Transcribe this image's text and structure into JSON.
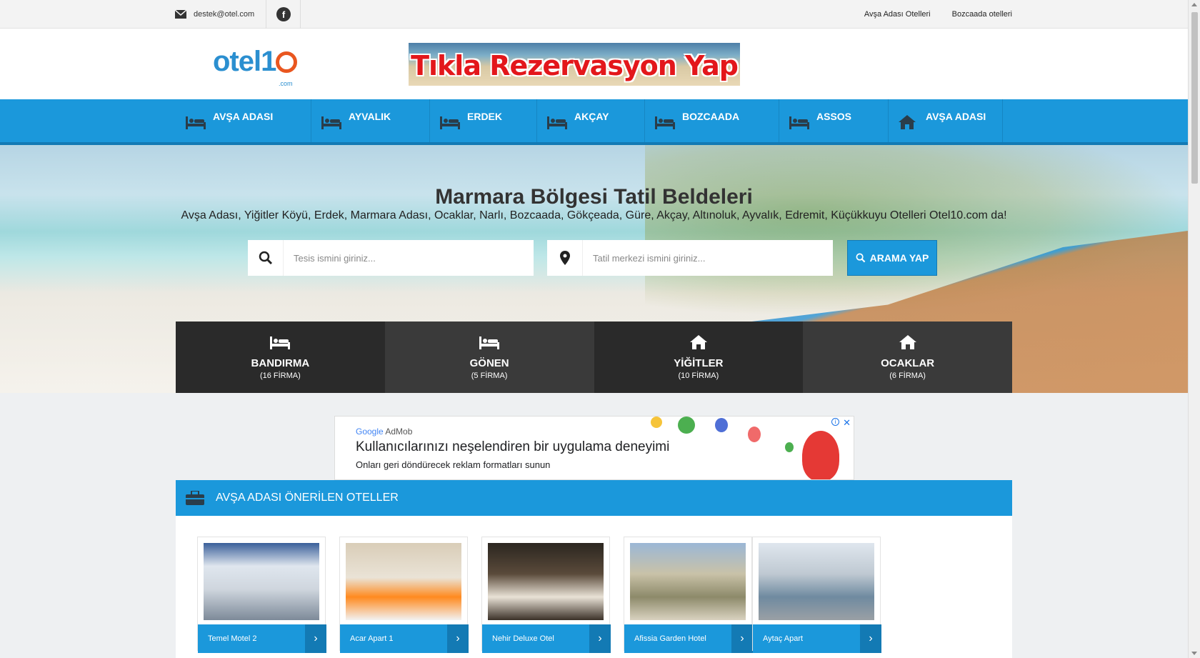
{
  "topbar": {
    "email": "destek@otel.com",
    "facebook_icon": "facebook-icon",
    "links": [
      "Avşa Adası Otelleri",
      "Bozcaada otelleri"
    ]
  },
  "header": {
    "logo_text_a": "otel1",
    "logo_text_b": ".com",
    "banner_text": "Tıkla Rezervasyon Yap"
  },
  "nav": {
    "items": [
      {
        "label": "AVŞA ADASI",
        "icon": "bed-icon"
      },
      {
        "label": "AYVALIK",
        "icon": "bed-icon"
      },
      {
        "label": "ERDEK",
        "icon": "bed-icon"
      },
      {
        "label": "AKÇAY",
        "icon": "bed-icon"
      },
      {
        "label": "BOZCAADA",
        "icon": "bed-icon"
      },
      {
        "label": "ASSOS",
        "icon": "bed-icon"
      },
      {
        "label": "AVŞA ADASI",
        "icon": "home-icon"
      }
    ]
  },
  "hero": {
    "title": "Marmara Bölgesi Tatil Beldeleri",
    "subtitle": "Avşa Adası, Yiğitler Köyü, Erdek, Marmara Adası, Ocaklar, Narlı, Bozcaada, Gökçeada, Güre, Akçay, Altınoluk, Ayvalık, Edremit, Küçükkuyu Otelleri Otel10.com da!",
    "search_name_placeholder": "Tesis ismini giriniz...",
    "search_location_placeholder": "Tatil merkezi ismini giriniz...",
    "search_button": "ARAMA YAP"
  },
  "tiles": [
    {
      "name": "BANDIRMA",
      "count": "(16 FİRMA)",
      "icon": "bed-icon"
    },
    {
      "name": "GÖNEN",
      "count": "(5 FİRMA)",
      "icon": "bed-icon"
    },
    {
      "name": "YİĞİTLER",
      "count": "(10 FİRMA)",
      "icon": "home-icon"
    },
    {
      "name": "OCAKLAR",
      "count": "(6 FİRMA)",
      "icon": "home-icon"
    }
  ],
  "ad": {
    "brand_g": "Google",
    "brand_rest": " AdMob",
    "headline": "Kullanıcılarınızı neşelendiren bir uygulama deneyimi",
    "description": "Onları geri döndürecek reklam formatları sunun"
  },
  "section": {
    "title": "AVŞA ADASI ÖNERİLEN OTELLER",
    "hotels": [
      {
        "name": "Temel Motel 2"
      },
      {
        "name": "Acar Apart 1"
      },
      {
        "name": "Nehir Deluxe Otel"
      },
      {
        "name": "Afissia Garden Hotel"
      },
      {
        "name": "Aytaç Apart"
      }
    ]
  },
  "colors": {
    "primary": "#1b98db",
    "primary_dark": "#137ab4",
    "tile_dark": "#2a2a2a",
    "tile_mid": "#3a3a3a",
    "logo_blue": "#2b8fd0",
    "logo_orange": "#e9561f",
    "banner_red": "#e3171b"
  }
}
